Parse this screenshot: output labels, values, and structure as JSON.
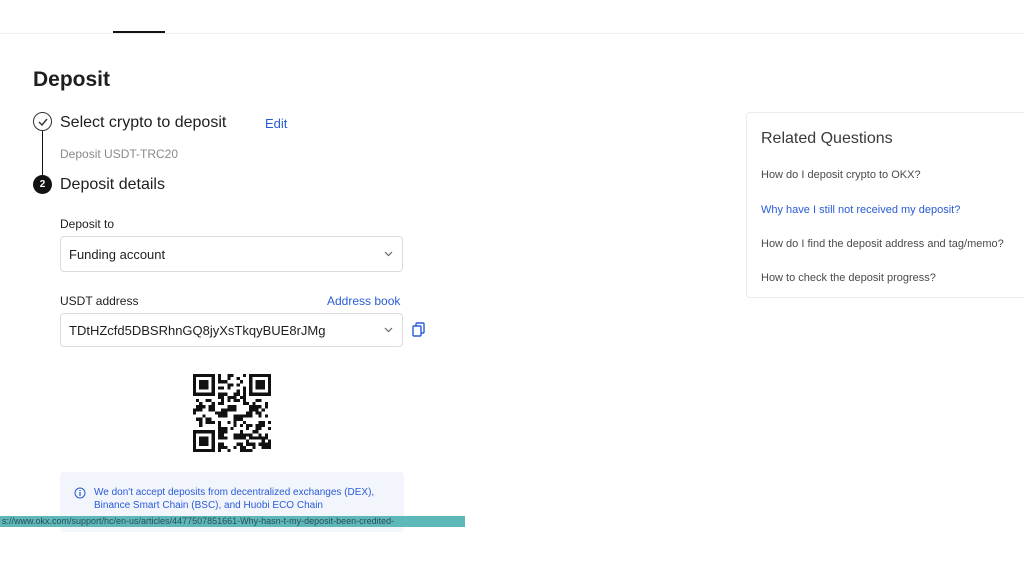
{
  "page": {
    "title": "Deposit"
  },
  "steps": {
    "step1": {
      "title": "Select crypto to deposit",
      "edit_label": "Edit",
      "summary": "Deposit USDT-TRC20"
    },
    "step2": {
      "number": "2",
      "title": "Deposit details"
    }
  },
  "deposit_to": {
    "label": "Deposit to",
    "value": "Funding account"
  },
  "address": {
    "label": "USDT address",
    "address_book_label": "Address book",
    "value": "TDtHZcfd5DBSRhnGQ8jyXsTkqyBUE8rJMg"
  },
  "notice": {
    "text": "We don't accept deposits from decentralized exchanges (DEX), Binance Smart Chain (BSC), and Huobi ECO Chain"
  },
  "status_bar": {
    "url": "s://www.okx.com/support/hc/en-us/articles/4477507851661-Why-hasn-t-my-deposit-been-credited-"
  },
  "related": {
    "title": "Related Questions",
    "questions": [
      "How do I deposit crypto to OKX?",
      "Why have I still not received my deposit?",
      "How do I find the deposit address and tag/memo?",
      "How to check the deposit progress?"
    ]
  },
  "icons": {
    "step1": "check-circle-icon",
    "dropdown": "chevron-down-icon",
    "copy": "copy-icon",
    "info": "info-icon"
  },
  "colors": {
    "link": "#2a5bd7",
    "status_bar": "#5fb8b8"
  }
}
